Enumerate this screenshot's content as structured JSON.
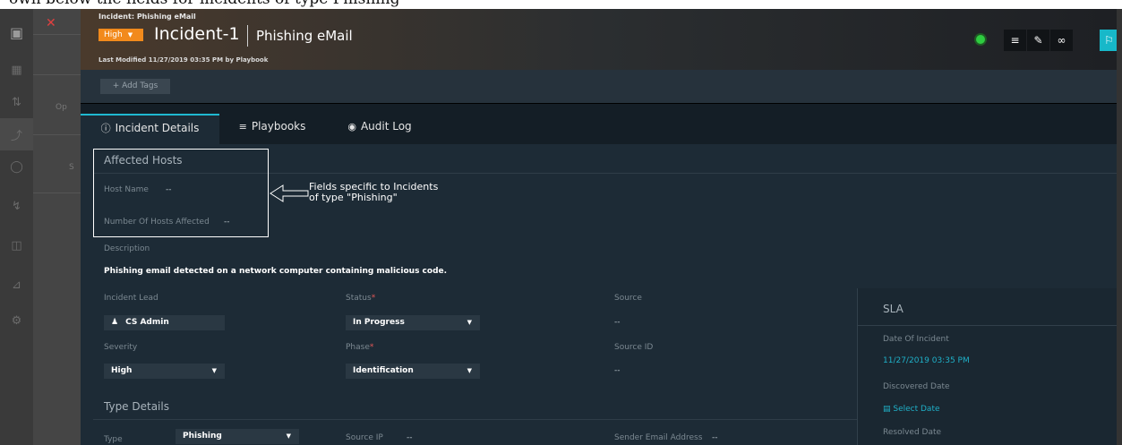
{
  "top_caption": "own below the fields for incidents of type Phishing",
  "sidebar": {
    "icons": [
      "dashboard-icon",
      "queue-icon",
      "incidents-icon",
      "shield-icon",
      "lightning-icon",
      "briefcase-icon",
      "chart-icon",
      "settings-icon"
    ],
    "overlay_ghost_text_1": "Op",
    "overlay_ghost_text_2": "S"
  },
  "header": {
    "breadcrumb": "Incident: Phishing eMail",
    "severity": "High",
    "incident_id": "Incident-1",
    "incident_name": "Phishing eMail",
    "last_modified": "Last Modified 11/27/2019 03:35 PM by Playbook",
    "status_color": "#2ecc40"
  },
  "tags": {
    "add_label": "+ Add Tags"
  },
  "tabs": [
    {
      "icon": "info-icon",
      "label": "Incident Details"
    },
    {
      "icon": "playbook-icon",
      "label": "Playbooks"
    },
    {
      "icon": "eye-icon",
      "label": "Audit Log"
    }
  ],
  "affected_hosts": {
    "title": "Affected Hosts",
    "host_name_label": "Host Name",
    "host_name_value": "--",
    "hosts_affected_label": "Number Of Hosts Affected",
    "hosts_affected_value": "--"
  },
  "annotation": {
    "line1": "Fields specific to Incidents",
    "line2": "of type \"Phishing\""
  },
  "description": {
    "label": "Description",
    "text": "Phishing email detected on a network computer containing malicious code."
  },
  "fields": {
    "incident_lead_label": "Incident Lead",
    "incident_lead_value": "CS Admin",
    "status_label": "Status",
    "status_value": "In Progress",
    "source_label": "Source",
    "source_value": "--",
    "severity_label": "Severity",
    "severity_value": "High",
    "phase_label": "Phase",
    "phase_value": "Identification",
    "source_id_label": "Source ID",
    "source_id_value": "--",
    "required_mark": "*"
  },
  "type_details": {
    "title": "Type Details",
    "type_label": "Type",
    "type_value": "Phishing",
    "source_ip_label": "Source IP",
    "source_ip_value": "--",
    "sender_email_label": "Sender Email Address",
    "sender_email_value": "--"
  },
  "sla": {
    "title": "SLA",
    "date_of_incident_label": "Date Of Incident",
    "date_of_incident_value": "11/27/2019 03:35 PM",
    "discovered_label": "Discovered Date",
    "discovered_value": "Select Date",
    "resolved_label": "Resolved Date"
  },
  "colors": {
    "accent": "#1fb9d1",
    "severity_high": "#f28a1c",
    "background": "#1d2b36"
  }
}
